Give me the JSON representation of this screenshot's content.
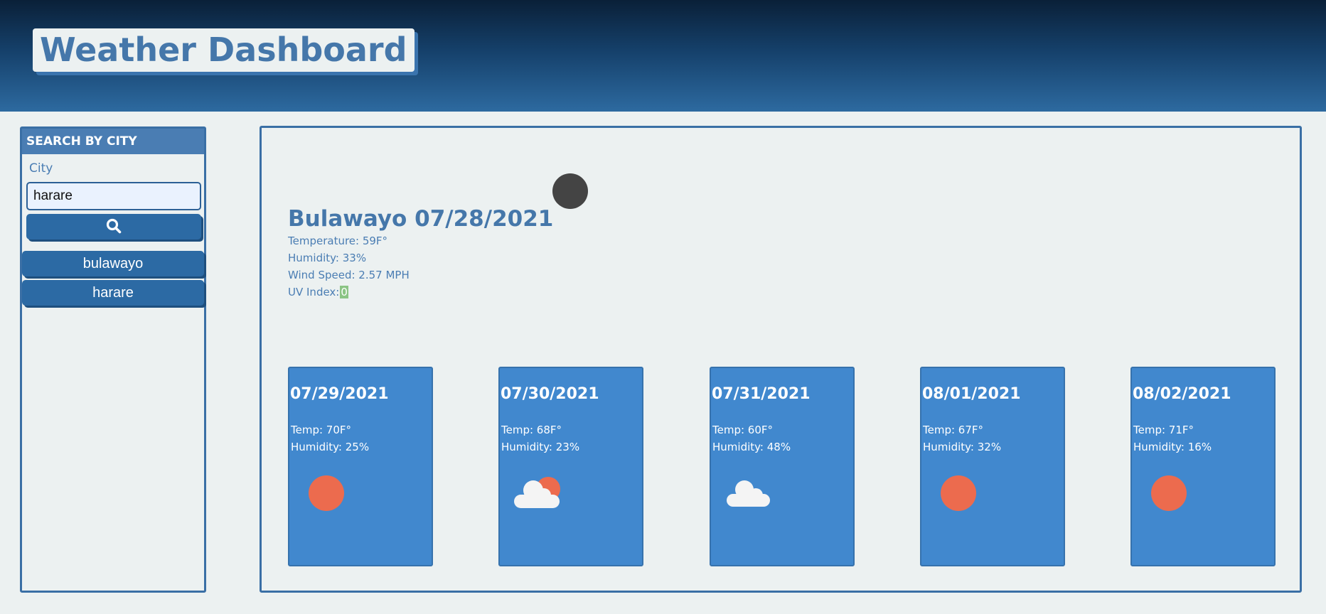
{
  "header": {
    "title": "Weather Dashboard"
  },
  "search": {
    "heading": "SEARCH BY CITY",
    "label": "City",
    "value": "harare",
    "button_icon": "search-icon"
  },
  "history": [
    {
      "label": "bulawayo"
    },
    {
      "label": "harare"
    }
  ],
  "current": {
    "city_date": "Bulawayo 07/28/2021",
    "icon": "dark-circle-icon",
    "temperature": "Temperature: 59F°",
    "humidity": "Humidity: 33%",
    "wind": "Wind Speed: 2.57 MPH",
    "uv_label": "UV Index:",
    "uv_value": "0"
  },
  "forecast": [
    {
      "date": "07/29/2021",
      "temp": "Temp: 70F°",
      "humidity": "Humidity: 25%",
      "icon": "sun-icon"
    },
    {
      "date": "07/30/2021",
      "temp": "Temp: 68F°",
      "humidity": "Humidity: 23%",
      "icon": "partly-cloudy-icon"
    },
    {
      "date": "07/31/2021",
      "temp": "Temp: 60F°",
      "humidity": "Humidity: 48%",
      "icon": "cloud-icon"
    },
    {
      "date": "08/01/2021",
      "temp": "Temp: 67F°",
      "humidity": "Humidity: 32%",
      "icon": "sun-icon"
    },
    {
      "date": "08/02/2021",
      "temp": "Temp: 71F°",
      "humidity": "Humidity: 16%",
      "icon": "sun-icon"
    }
  ],
  "colors": {
    "header_dark": "#0a2038",
    "accent": "#4577aa",
    "button": "#2c6aa4",
    "card": "#4188ce",
    "sun": "#ec6b4e",
    "uv_badge": "#8bc485"
  }
}
